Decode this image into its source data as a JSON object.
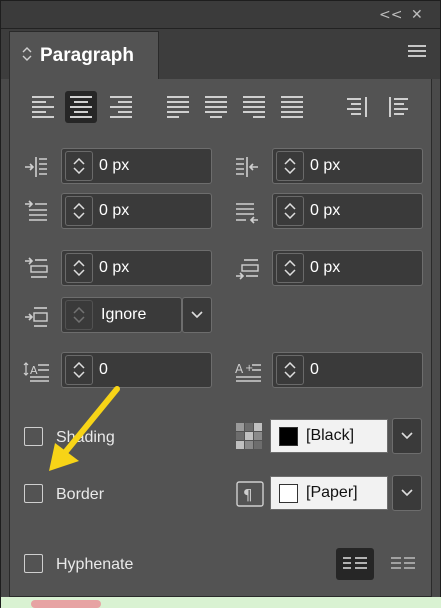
{
  "window": {
    "collapse_label": "<<",
    "close_label": "✕"
  },
  "tab": {
    "title": "Paragraph"
  },
  "alignment": {
    "buttons": [
      "align-left",
      "align-center",
      "align-right",
      "justify-left",
      "justify-center",
      "justify-right",
      "justify-all",
      "align-toward-spine",
      "align-away-from-spine"
    ],
    "selected": "align-center"
  },
  "indents": {
    "left_indent": "0 px",
    "right_indent": "0 px",
    "first_line_indent": "0 px",
    "last_line_indent": "0 px"
  },
  "spacing": {
    "space_before": "0 px",
    "space_after": "0 px",
    "align_to_grid": "Ignore"
  },
  "drop_cap": {
    "lines": "0",
    "characters": "0"
  },
  "shading": {
    "label": "Shading",
    "checked": false,
    "color_name": "[Black]",
    "color": "#000000"
  },
  "border": {
    "label": "Border",
    "checked": false,
    "color_name": "[Paper]",
    "color": "#ffffff"
  },
  "hyphenate": {
    "label": "Hyphenate",
    "checked": false
  },
  "annotation": {
    "arrow_color": "#f7d417"
  }
}
